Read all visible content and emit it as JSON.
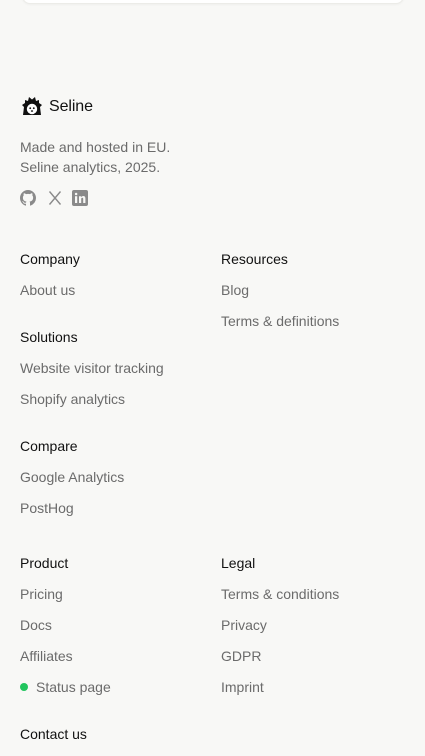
{
  "brand": {
    "name": "Seline",
    "tagline_line1": "Made and hosted in EU.",
    "tagline_line2": "Seline analytics, 2025.",
    "logo_icon": "hedgehog-logo-icon"
  },
  "socials": [
    {
      "name": "GitHub",
      "icon": "github-icon"
    },
    {
      "name": "X",
      "icon": "x-icon"
    },
    {
      "name": "LinkedIn",
      "icon": "linkedin-icon"
    }
  ],
  "sections": {
    "company": {
      "heading": "Company",
      "links": [
        "About us"
      ]
    },
    "resources": {
      "heading": "Resources",
      "links": [
        "Blog",
        "Terms & definitions"
      ]
    },
    "solutions": {
      "heading": "Solutions",
      "links": [
        "Website visitor tracking",
        "Shopify analytics"
      ]
    },
    "compare": {
      "heading": "Compare",
      "links": [
        "Google Analytics",
        "PostHog"
      ]
    },
    "product": {
      "heading": "Product",
      "links": [
        "Pricing",
        "Docs",
        "Affiliates",
        "Status page"
      ]
    },
    "legal": {
      "heading": "Legal",
      "links": [
        "Terms & conditions",
        "Privacy",
        "GDPR",
        "Imprint"
      ]
    },
    "contact": {
      "heading": "Contact us"
    }
  },
  "colors": {
    "background": "#f8f8f6",
    "heading": "#111111",
    "link": "#6b6b6b",
    "status_ok": "#22c55e",
    "icon": "#8a8a8a"
  }
}
